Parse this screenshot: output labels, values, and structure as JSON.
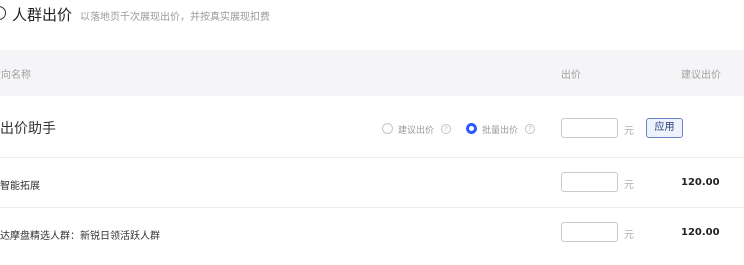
{
  "header": {
    "title": "人群出价",
    "hint": "以落地页千次展现出价，并按真实展现扣费"
  },
  "table": {
    "columns": {
      "name": "定向名称",
      "bid": "出价",
      "suggested": "建议出价"
    },
    "assistant_row": {
      "title": "出价助手",
      "option_suggested": "建议出价",
      "option_batch": "批量出价",
      "selected": "批量出价",
      "input_value": "",
      "unit": "元",
      "apply_label": "应用"
    },
    "rows": [
      {
        "name": "智能拓展",
        "bid": "",
        "unit": "元",
        "suggested": "120.00"
      },
      {
        "name": "达摩盘精选人群：新锐日领活跃人群",
        "bid": "",
        "unit": "元",
        "suggested": "120.00"
      }
    ]
  },
  "colors": {
    "accent": "#2a5bff",
    "header_bg": "#f5f5f7",
    "apply_border": "#6f83c8"
  }
}
